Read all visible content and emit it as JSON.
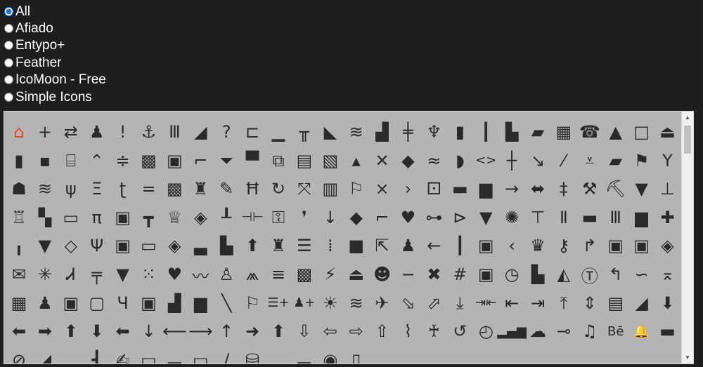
{
  "filters": {
    "selected": "All",
    "options": [
      "All",
      "Afiado",
      "Entypo+",
      "Feather",
      "IcoMoon - Free",
      "Simple Icons"
    ]
  },
  "icons": [
    {
      "name": "home-icon",
      "glyph": "⌂",
      "accent": true
    },
    {
      "name": "plus-icon",
      "glyph": "+"
    },
    {
      "name": "swap-icon",
      "glyph": "⇄"
    },
    {
      "name": "bell-icon",
      "glyph": "♟"
    },
    {
      "name": "exclamation-icon",
      "glyph": "!"
    },
    {
      "name": "anchor-icon",
      "glyph": "⚓"
    },
    {
      "name": "columns-icon",
      "glyph": "Ⅲ"
    },
    {
      "name": "signal-icon",
      "glyph": "◢"
    },
    {
      "name": "question-icon",
      "glyph": "?"
    },
    {
      "name": "tag-icon",
      "glyph": "⊏"
    },
    {
      "name": "align-bottom-icon",
      "glyph": "▁"
    },
    {
      "name": "table-icon",
      "glyph": "╥"
    },
    {
      "name": "zoom-icon",
      "glyph": "◣"
    },
    {
      "name": "wave-icon",
      "glyph": "≋"
    },
    {
      "name": "chart-icon",
      "glyph": "▟"
    },
    {
      "name": "split-icon",
      "glyph": "╪"
    },
    {
      "name": "pin-icon",
      "glyph": "♆"
    },
    {
      "name": "bookmark-icon",
      "glyph": "▮"
    },
    {
      "name": "audio-icon",
      "glyph": "┃"
    },
    {
      "name": "factory-icon",
      "glyph": "▙"
    },
    {
      "name": "folder-icon",
      "glyph": "▰"
    },
    {
      "name": "grid-icon",
      "glyph": "▦"
    },
    {
      "name": "phone-icon",
      "glyph": "☎"
    },
    {
      "name": "chevron-up-icon",
      "glyph": "▲"
    },
    {
      "name": "square-icon",
      "glyph": "□"
    },
    {
      "name": "eject-icon",
      "glyph": "⏏"
    },
    {
      "name": "battery-icon",
      "glyph": "▮"
    },
    {
      "name": "dots-icon",
      "glyph": "▪"
    },
    {
      "name": "frame-icon",
      "glyph": "⌸"
    },
    {
      "name": "trend-icon",
      "glyph": "⌃"
    },
    {
      "name": "sort-icon",
      "glyph": "≑"
    },
    {
      "name": "checker-icon",
      "glyph": "▩"
    },
    {
      "name": "briefcase-icon",
      "glyph": "▣"
    },
    {
      "name": "crop-icon",
      "glyph": "⌐"
    },
    {
      "name": "filter-icon",
      "glyph": "⏷"
    },
    {
      "name": "shirt-icon",
      "glyph": "▀"
    },
    {
      "name": "copy-icon",
      "glyph": "⧉"
    },
    {
      "name": "file-icon",
      "glyph": "▤"
    },
    {
      "name": "qr-icon",
      "glyph": "▧"
    },
    {
      "name": "mountain-icon",
      "glyph": "▴"
    },
    {
      "name": "cross-icon",
      "glyph": "✕"
    },
    {
      "name": "diamond-icon",
      "glyph": "◆"
    },
    {
      "name": "waves-icon",
      "glyph": "≈"
    },
    {
      "name": "shield-icon",
      "glyph": "◗"
    },
    {
      "name": "code-icon",
      "glyph": "<>"
    },
    {
      "name": "plus-bar-icon",
      "glyph": "┼"
    },
    {
      "name": "arrow-down-right-icon",
      "glyph": "↘"
    },
    {
      "name": "pencil-icon",
      "glyph": "⁄"
    },
    {
      "name": "download-icon",
      "glyph": "⩡"
    },
    {
      "name": "save-icon",
      "glyph": "▰"
    },
    {
      "name": "flag-icon",
      "glyph": "⚑"
    },
    {
      "name": "cocktail-icon",
      "glyph": "Y"
    },
    {
      "name": "invader-icon",
      "glyph": "☗"
    },
    {
      "name": "wave-lines-icon",
      "glyph": "≋"
    },
    {
      "name": "tools-icon",
      "glyph": "ψ"
    },
    {
      "name": "brackets-icon",
      "glyph": "Ξ"
    },
    {
      "name": "hook-icon",
      "glyph": "ʈ"
    },
    {
      "name": "equals-icon",
      "glyph": "="
    },
    {
      "name": "calendar-icon",
      "glyph": "▩"
    },
    {
      "name": "castle-icon",
      "glyph": "♜"
    },
    {
      "name": "pen-icon",
      "glyph": "✎"
    },
    {
      "name": "frame2-icon",
      "glyph": "Ħ"
    },
    {
      "name": "rotate-icon",
      "glyph": "↻"
    },
    {
      "name": "crossed-icon",
      "glyph": "⤧"
    },
    {
      "name": "book-icon",
      "glyph": "▥"
    },
    {
      "name": "flag2-icon",
      "glyph": "⚐"
    },
    {
      "name": "times-icon",
      "glyph": "×"
    },
    {
      "name": "chevron-right-icon",
      "glyph": "›"
    },
    {
      "name": "dice-icon",
      "glyph": "⚀"
    },
    {
      "name": "gamepad-icon",
      "glyph": "▬"
    },
    {
      "name": "basket-icon",
      "glyph": "▆"
    },
    {
      "name": "arrow-right-icon",
      "glyph": "→"
    },
    {
      "name": "diamond-arrows-icon",
      "glyph": "⬌"
    },
    {
      "name": "hashtag-icon",
      "glyph": "‡"
    },
    {
      "name": "hammer-icon",
      "glyph": "⚒"
    },
    {
      "name": "axe-icon",
      "glyph": "⛏"
    },
    {
      "name": "ribbon-icon",
      "glyph": "▼"
    },
    {
      "name": "sitemap-icon",
      "glyph": "⊥"
    },
    {
      "name": "fortress-icon",
      "glyph": "♖"
    },
    {
      "name": "puzzle-icon",
      "glyph": "▚"
    },
    {
      "name": "tray-icon",
      "glyph": "▭"
    },
    {
      "name": "pi-icon",
      "glyph": "π"
    },
    {
      "name": "lock-icon",
      "glyph": "▣"
    },
    {
      "name": "tee-icon",
      "glyph": "┳"
    },
    {
      "name": "crown-icon",
      "glyph": "♕"
    },
    {
      "name": "label-icon",
      "glyph": "◈"
    },
    {
      "name": "thumbtack-icon",
      "glyph": "┸"
    },
    {
      "name": "dumbbell-icon",
      "glyph": "⊣⊢"
    },
    {
      "name": "key-icon",
      "glyph": "⚿"
    },
    {
      "name": "comma-icon",
      "glyph": "❜"
    },
    {
      "name": "arrow-down-icon",
      "glyph": "↓"
    },
    {
      "name": "rhombus-icon",
      "glyph": "◆"
    },
    {
      "name": "step-icon",
      "glyph": "⌐"
    },
    {
      "name": "heart-icon",
      "glyph": "♥"
    },
    {
      "name": "fork-icon",
      "glyph": "⊶"
    },
    {
      "name": "merge-icon",
      "glyph": "⊳"
    },
    {
      "name": "funnel-icon",
      "glyph": "▼"
    },
    {
      "name": "settings-icon",
      "glyph": "✺"
    },
    {
      "name": "align-icon",
      "glyph": "⊤"
    },
    {
      "name": "pause-icon",
      "glyph": "Ⅱ"
    },
    {
      "name": "card-icon",
      "glyph": "▬"
    },
    {
      "name": "shop-icon",
      "glyph": "Ⅲ"
    },
    {
      "name": "camera-icon",
      "glyph": "▆"
    },
    {
      "name": "pushpin-icon",
      "glyph": "✚"
    },
    {
      "name": "bars-icon",
      "glyph": "╻"
    },
    {
      "name": "plug-icon",
      "glyph": "▼"
    },
    {
      "name": "rotate-square-icon",
      "glyph": "◇"
    },
    {
      "name": "socket-icon",
      "glyph": "Ψ"
    },
    {
      "name": "cat-icon",
      "glyph": "▣"
    },
    {
      "name": "tv-icon",
      "glyph": "▭"
    },
    {
      "name": "eraser-icon",
      "glyph": "◈"
    },
    {
      "name": "monitor-icon",
      "glyph": "▃"
    },
    {
      "name": "bed-icon",
      "glyph": "▙"
    },
    {
      "name": "arrow-up-icon",
      "glyph": "⬆"
    },
    {
      "name": "hydrant-icon",
      "glyph": "♜"
    },
    {
      "name": "menu-lines-icon",
      "glyph": "☰"
    },
    {
      "name": "dot-grid-icon",
      "glyph": "⁞"
    },
    {
      "name": "stop-icon",
      "glyph": "■"
    },
    {
      "name": "share-icon",
      "glyph": "⇱"
    },
    {
      "name": "signpost-icon",
      "glyph": "♟"
    },
    {
      "name": "arrow-left-icon",
      "glyph": "←"
    },
    {
      "name": "equalizer-icon",
      "glyph": "┃"
    },
    {
      "name": "expand-icon",
      "glyph": "▣"
    },
    {
      "name": "chevron-left-icon",
      "glyph": "‹"
    },
    {
      "name": "crown2-icon",
      "glyph": "♛"
    },
    {
      "name": "wrench-icon",
      "glyph": "⚷"
    },
    {
      "name": "redo-icon",
      "glyph": "↱"
    },
    {
      "name": "robot-icon",
      "glyph": "▣"
    },
    {
      "name": "date-icon",
      "glyph": "▣"
    },
    {
      "name": "search-tag-icon",
      "glyph": "◈"
    },
    {
      "name": "mail-icon",
      "glyph": "✉"
    },
    {
      "name": "bug-icon",
      "glyph": "✳"
    },
    {
      "name": "chair-icon",
      "glyph": "Ꮧ"
    },
    {
      "name": "bench-icon",
      "glyph": "╤"
    },
    {
      "name": "shield2-icon",
      "glyph": "▼"
    },
    {
      "name": "grid2-icon",
      "glyph": "⁙"
    },
    {
      "name": "heart2-icon",
      "glyph": "♥"
    },
    {
      "name": "zigzag-icon",
      "glyph": "〰"
    },
    {
      "name": "chess-icon",
      "glyph": "♙"
    },
    {
      "name": "peak-icon",
      "glyph": "⩕"
    },
    {
      "name": "list-icon",
      "glyph": "≡"
    },
    {
      "name": "block-icon",
      "glyph": "▩"
    },
    {
      "name": "lightning-icon",
      "glyph": "⚡"
    },
    {
      "name": "eject2-icon",
      "glyph": "⏏"
    },
    {
      "name": "smiley-icon",
      "glyph": "☻"
    },
    {
      "name": "minus-icon",
      "glyph": "−"
    },
    {
      "name": "x-diamond-icon",
      "glyph": "✖"
    },
    {
      "name": "hash-icon",
      "glyph": "#"
    },
    {
      "name": "target-icon",
      "glyph": "▣"
    },
    {
      "name": "clock-square-icon",
      "glyph": "◷"
    },
    {
      "name": "stairs-icon",
      "glyph": "▙"
    },
    {
      "name": "map-icon",
      "glyph": "◭"
    },
    {
      "name": "text-box-icon",
      "glyph": "Ⓣ"
    },
    {
      "name": "return-icon",
      "glyph": "↰"
    },
    {
      "name": "curve-icon",
      "glyph": "∽"
    },
    {
      "name": "upload-icon",
      "glyph": "⌅"
    },
    {
      "name": "building-icon",
      "glyph": "▦"
    },
    {
      "name": "user-icon",
      "glyph": "♟"
    },
    {
      "name": "display-icon",
      "glyph": "▣"
    },
    {
      "name": "screen-icon",
      "glyph": "▢"
    },
    {
      "name": "vest-icon",
      "glyph": "Ч"
    },
    {
      "name": "tablet-icon",
      "glyph": "▣"
    },
    {
      "name": "ship-icon",
      "glyph": "▟"
    },
    {
      "name": "archive-icon",
      "glyph": "▆"
    },
    {
      "name": "slash-icon",
      "glyph": "╲"
    },
    {
      "name": "milestone-icon",
      "glyph": "⚐"
    },
    {
      "name": "list-add-icon",
      "glyph": "☰+"
    },
    {
      "name": "user-add-icon",
      "glyph": "♟+"
    },
    {
      "name": "brightness-icon",
      "glyph": "☀"
    },
    {
      "name": "waves2-icon",
      "glyph": "≋"
    },
    {
      "name": "airplane-icon",
      "glyph": "✈"
    },
    {
      "name": "landing-icon",
      "glyph": "⬂"
    },
    {
      "name": "takeoff-icon",
      "glyph": "⬀"
    },
    {
      "name": "align-down-icon",
      "glyph": "⤓"
    },
    {
      "name": "shrink-icon",
      "glyph": "⇥⇤"
    },
    {
      "name": "arrow-to-left-icon",
      "glyph": "⇤"
    },
    {
      "name": "arrow-to-right-icon",
      "glyph": "⇥"
    },
    {
      "name": "arrow-to-top-icon",
      "glyph": "⤒"
    },
    {
      "name": "vertical-align-icon",
      "glyph": "⇕"
    },
    {
      "name": "inbox-icon",
      "glyph": "▤"
    },
    {
      "name": "area-chart-icon",
      "glyph": "◢"
    },
    {
      "name": "arrow-down-bold-icon",
      "glyph": "⬇"
    },
    {
      "name": "arrow-left-bold-icon",
      "glyph": "⬅"
    },
    {
      "name": "arrow-right-bold-icon",
      "glyph": "➡"
    },
    {
      "name": "arrow-up-bold-icon",
      "glyph": "⬆"
    },
    {
      "name": "arrow-down-bold2-icon",
      "glyph": "⬇"
    },
    {
      "name": "arrow-left-bold2-icon",
      "glyph": "⬅"
    },
    {
      "name": "long-arrow-down-icon",
      "glyph": "↓"
    },
    {
      "name": "long-arrow-left-icon",
      "glyph": "⟵"
    },
    {
      "name": "long-arrow-right-icon",
      "glyph": "⟶"
    },
    {
      "name": "long-arrow-up-icon",
      "glyph": "↑"
    },
    {
      "name": "arrow-right-plain-icon",
      "glyph": "➜"
    },
    {
      "name": "arrow-up-plain-icon",
      "glyph": "⬆"
    },
    {
      "name": "circle-arrow-down-icon",
      "glyph": "⇩"
    },
    {
      "name": "circle-arrow-left-icon",
      "glyph": "⇦"
    },
    {
      "name": "circle-arrow-right-icon",
      "glyph": "⇨"
    },
    {
      "name": "circle-arrow-up-icon",
      "glyph": "⇧"
    },
    {
      "name": "paperclip-icon",
      "glyph": "⌇"
    },
    {
      "name": "awareness-ribbon-icon",
      "glyph": "♰"
    },
    {
      "name": "loop-icon",
      "glyph": "↺"
    },
    {
      "name": "history-icon",
      "glyph": "◴"
    },
    {
      "name": "bar-chart-icon",
      "glyph": "▂▄▆"
    },
    {
      "name": "drop-icon",
      "glyph": "☁"
    },
    {
      "name": "tag-label-icon",
      "glyph": "⊸"
    },
    {
      "name": "music-icon",
      "glyph": "♫"
    },
    {
      "name": "behance-icon",
      "glyph": "Bē"
    },
    {
      "name": "bell2-icon",
      "glyph": "🔔"
    },
    {
      "name": "case-icon",
      "glyph": "▬"
    },
    {
      "name": "ban-icon",
      "glyph": "⊘"
    },
    {
      "name": "tag-angle-icon",
      "glyph": "◢"
    },
    {
      "name": "stamp-icon",
      "glyph": "▂"
    },
    {
      "name": "plug2-icon",
      "glyph": "┫"
    },
    {
      "name": "pen2-icon",
      "glyph": "✍"
    },
    {
      "name": "layout-icon",
      "glyph": "▭"
    },
    {
      "name": "toolbox-icon",
      "glyph": "▃"
    },
    {
      "name": "window-icon",
      "glyph": "▭"
    },
    {
      "name": "pencil2-icon",
      "glyph": "∕"
    },
    {
      "name": "database-icon",
      "glyph": "⛁"
    },
    {
      "name": "apple-icon",
      "glyph": ""
    },
    {
      "name": "cart-icon",
      "glyph": "▃"
    },
    {
      "name": "camera2-icon",
      "glyph": "◉"
    },
    {
      "name": "phone2-icon",
      "glyph": "▯"
    }
  ],
  "scrollbar": {
    "up_glyph": "▲",
    "down_glyph": "▼"
  }
}
